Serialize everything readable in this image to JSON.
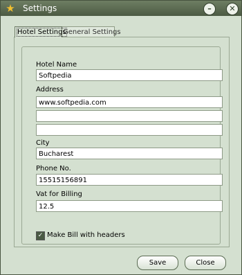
{
  "window": {
    "title": "Settings"
  },
  "tabs": [
    {
      "label": "Hotel Settings"
    },
    {
      "label": "General Settings"
    }
  ],
  "form": {
    "hotel_name_label": "Hotel Name",
    "hotel_name_value": "Softpedia",
    "address_label": "Address",
    "address_line1": "www.softpedia.com",
    "address_line2": "",
    "address_line3": "",
    "city_label": "City",
    "city_value": "Bucharest",
    "phone_label": "Phone No.",
    "phone_value": "15515156891",
    "vat_label": "Vat for Billing",
    "vat_value": "12.5",
    "make_bill_label": "Make Bill with headers",
    "make_bill_checked": true
  },
  "buttons": {
    "save": "Save",
    "close": "Close"
  },
  "icons": {
    "app": "star-icon",
    "minimize": "minimize-icon",
    "close": "close-icon"
  }
}
